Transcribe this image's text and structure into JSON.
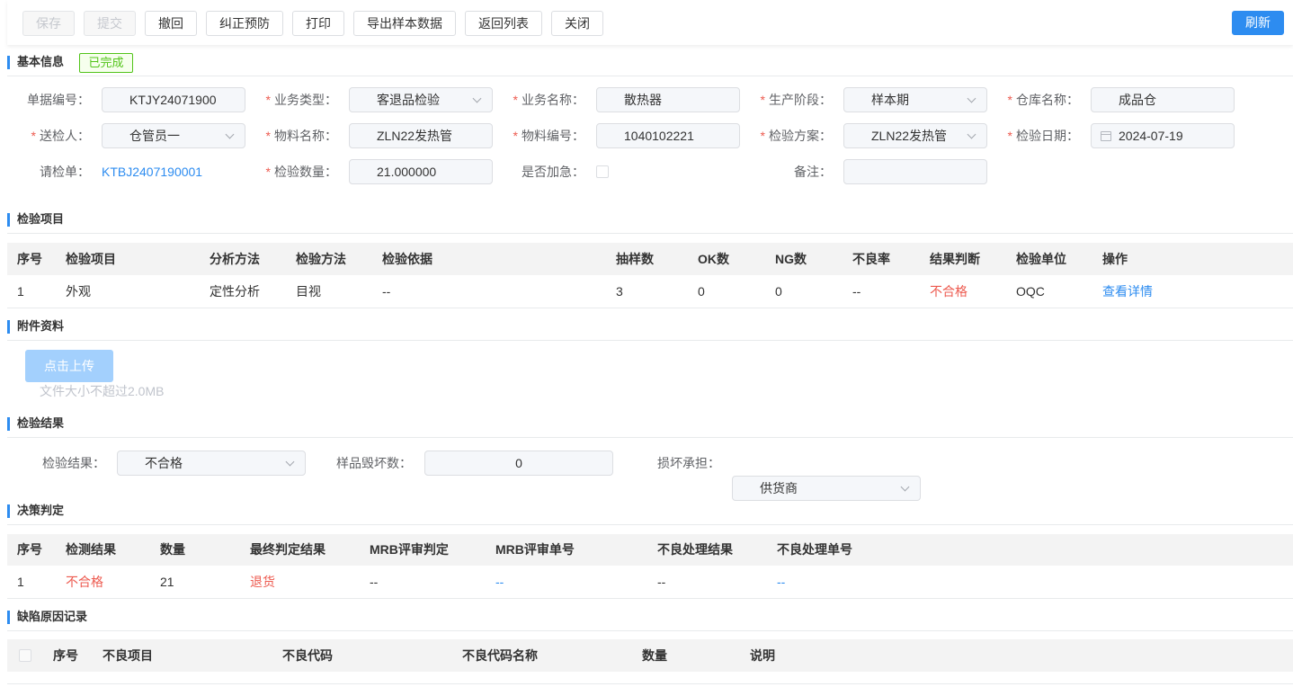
{
  "colors": {
    "primary": "#2d8cf0",
    "danger": "#ed5a4f",
    "success": "#52c41a",
    "upload": "#a3d0fd"
  },
  "toolbar": {
    "buttons": [
      {
        "label": "保存",
        "disabled": true
      },
      {
        "label": "提交",
        "disabled": true
      },
      {
        "label": "撤回",
        "disabled": false
      },
      {
        "label": "纠正预防",
        "disabled": false
      },
      {
        "label": "打印",
        "disabled": false
      },
      {
        "label": "导出样本数据",
        "disabled": false
      },
      {
        "label": "返回列表",
        "disabled": false
      },
      {
        "label": "关闭",
        "disabled": false
      }
    ],
    "refresh": "刷新"
  },
  "required_mark": "*",
  "basic_info": {
    "title": "基本信息",
    "status": "已完成",
    "fields": [
      {
        "label": "单据编号：",
        "value": "KTJY24071900",
        "required": false
      },
      {
        "label": "业务类型：",
        "value": "客退品检验",
        "required": true,
        "icon": "chevron-down-icon"
      },
      {
        "label": "业务名称：",
        "value": "散热器",
        "required": true
      },
      {
        "label": "生产阶段：",
        "value": "样本期",
        "required": true,
        "icon": "chevron-down-icon"
      },
      {
        "label": "仓库名称：",
        "value": "成品仓",
        "required": true
      },
      {
        "label": "送检人：",
        "value": "仓管员一",
        "required": true,
        "icon": "chevron-down-icon"
      },
      {
        "label": "物料名称：",
        "value": "ZLN22发热管",
        "required": true
      },
      {
        "label": "物料编号：",
        "value": "1040102221",
        "required": true
      },
      {
        "label": "检验方案：",
        "value": "ZLN22发热管",
        "required": true,
        "icon": "chevron-down-icon"
      },
      {
        "label": "检验日期：",
        "value": "2024-07-19",
        "required": true,
        "icon": "calendar-icon"
      },
      {
        "label": "请检单：",
        "value": "KTBJ2407190001",
        "required": false
      },
      {
        "label": "检验数量：",
        "value": "21.000000",
        "required": true
      },
      {
        "label": "是否加急：",
        "checked": false,
        "required": false
      },
      {
        "label": "备注：",
        "value": "",
        "required": false
      }
    ]
  },
  "inspection_items": {
    "title": "检验项目",
    "columns": [
      "序号",
      "检验项目",
      "分析方法",
      "检验方法",
      "检验依据",
      "抽样数",
      "OK数",
      "NG数",
      "不良率",
      "结果判断",
      "检验单位",
      "操作"
    ],
    "rows": [
      [
        "1",
        "外观",
        "定性分析",
        "目视",
        "--",
        "3",
        "0",
        "0",
        "--",
        "不合格",
        "OQC",
        "查看详情"
      ]
    ]
  },
  "attachments": {
    "title": "附件资料",
    "upload_button": "点击上传",
    "hint": "文件大小不超过2.0MB"
  },
  "inspection_result": {
    "title": "检验结果",
    "result": {
      "label": "检验结果：",
      "value": "不合格"
    },
    "damaged_samples": {
      "label": "样品毁坏数：",
      "value": "0"
    },
    "damage_bearer": {
      "label": "损坏承担：",
      "value": "供货商"
    }
  },
  "decision": {
    "title": "决策判定",
    "columns": [
      "序号",
      "检测结果",
      "数量",
      "最终判定结果",
      "MRB评审判定",
      "MRB评审单号",
      "不良处理结果",
      "不良处理单号"
    ],
    "rows": [
      [
        "1",
        "不合格",
        "21",
        "退货",
        "--",
        "--",
        "--",
        "--"
      ]
    ]
  },
  "defect_causes": {
    "title": "缺陷原因记录",
    "select_all_checked": false,
    "columns": [
      "序号",
      "不良项目",
      "不良代码",
      "不良代码名称",
      "数量",
      "说明"
    ],
    "rows": []
  }
}
